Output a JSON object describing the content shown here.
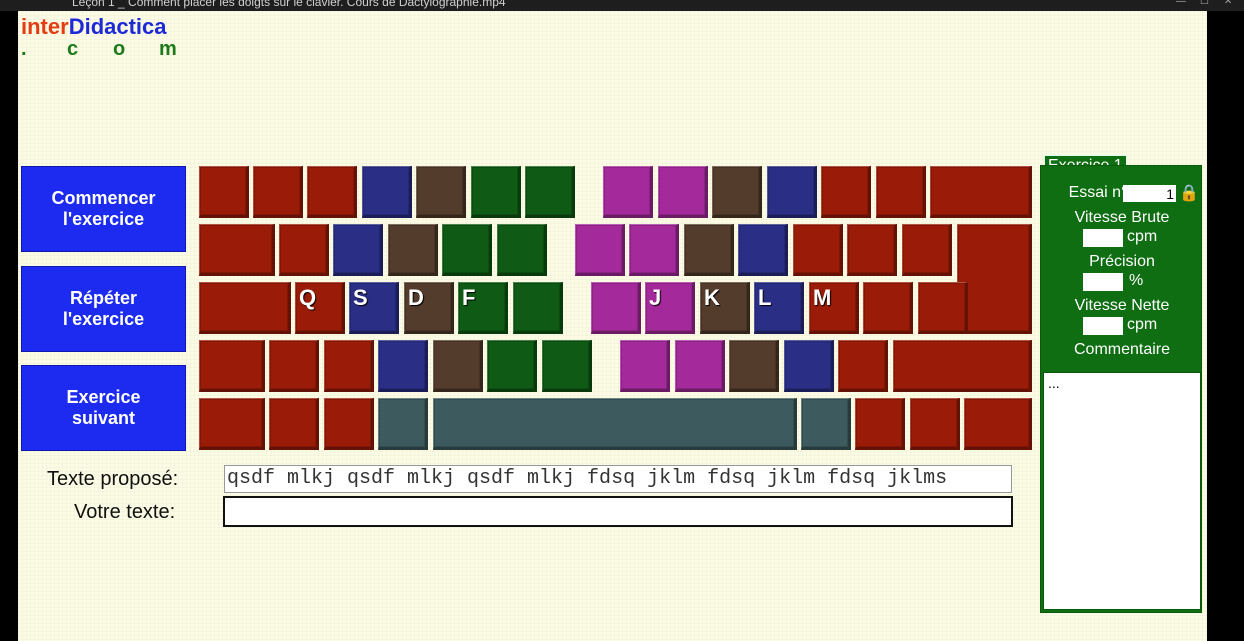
{
  "window": {
    "title": "Leçon 1 _ Comment placer les doigts sur le clavier. Cours de Dactylographie.mp4"
  },
  "logo": {
    "part1": "inter",
    "part2": "Didactica",
    "dot": ".",
    "c": "c",
    "o": "o",
    "m": "m"
  },
  "buttons": {
    "start": "Commencer\nl'exercice",
    "repeat": "Répéter\nl'exercice",
    "next": "Exercice\nsuivant"
  },
  "keyboard": {
    "colors": {
      "red": "#9a1c08",
      "blue": "#2b2e85",
      "brown": "#533c2c",
      "green": "#0f5a14",
      "purple": "#a42a9b",
      "teal": "#3d5a5e"
    },
    "home_row_labels": {
      "q": "Q",
      "s": "S",
      "d": "D",
      "f": "F",
      "j": "J",
      "k": "K",
      "l": "L",
      "m": "M"
    }
  },
  "texte": {
    "label_propose": "Texte proposé:",
    "label_votre": "Votre texte:",
    "propose": "qsdf mlkj qsdf mlkj qsdf mlkj fdsq jklm fdsq jklm fdsq jklms",
    "votre": ""
  },
  "panel": {
    "tab": "Exercice 1",
    "essai_label": "Essai n°",
    "essai_value": "1",
    "vitesse_brute_label": "Vitesse Brute",
    "vitesse_brute_value": "",
    "precision_label": "Précision",
    "precision_value": "",
    "vitesse_nette_label": "Vitesse Nette",
    "vitesse_nette_value": "",
    "unit_cpm": "cpm",
    "unit_pct": "%",
    "commentaire_label": "Commentaire",
    "commentaire": "..."
  }
}
